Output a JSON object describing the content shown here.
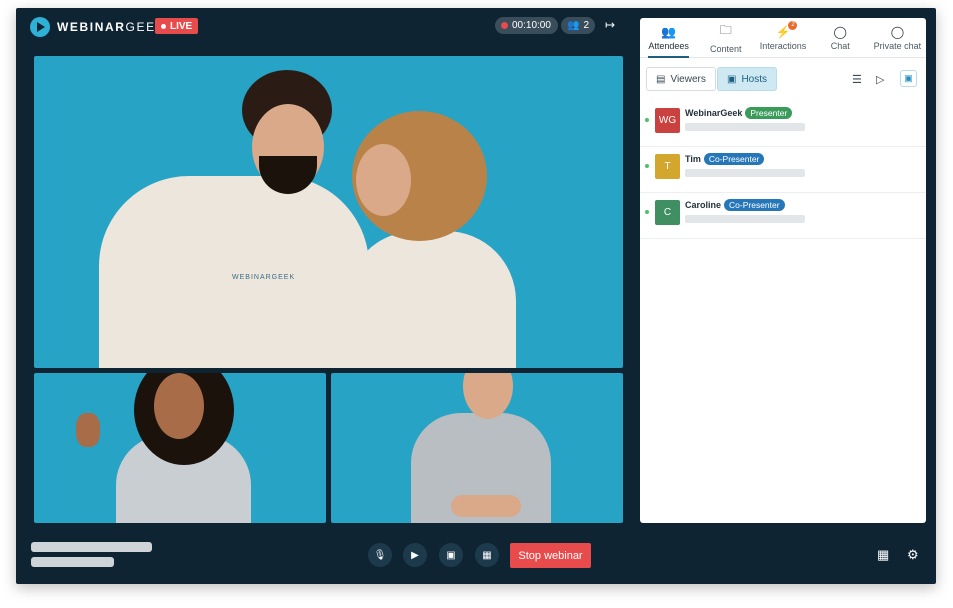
{
  "header": {
    "logo_bold": "WEBINAR",
    "logo_light": "GEEK",
    "live_label": "LIVE",
    "timer": "00:10:00",
    "attendee_count": "2"
  },
  "video": {
    "main_hoodie_text": "WEBINARGEEK"
  },
  "controls": {
    "stop_label": "Stop webinar"
  },
  "panel": {
    "tabs": [
      {
        "label": "Attendees",
        "icon": "people-icon"
      },
      {
        "label": "Content",
        "icon": "folder-icon"
      },
      {
        "label": "Interactions",
        "icon": "bolt-icon",
        "badge": "2"
      },
      {
        "label": "Chat",
        "icon": "chat-icon"
      },
      {
        "label": "Private chat",
        "icon": "private-chat-icon"
      }
    ],
    "filters": {
      "viewers_label": "Viewers",
      "hosts_label": "Hosts"
    },
    "hosts": [
      {
        "initials": "WG",
        "name": "WebinarGeek",
        "role": "Presenter",
        "color": "#c9423f"
      },
      {
        "initials": "T",
        "name": "Tim",
        "role": "Co-Presenter",
        "color": "#d3a72e"
      },
      {
        "initials": "C",
        "name": "Caroline",
        "role": "Co-Presenter",
        "color": "#3f8f62"
      }
    ]
  },
  "colors": {
    "background": "#0f2433",
    "video_bg": "#27a3c6",
    "live": "#e84b4b",
    "accent": "#1c5f80"
  }
}
